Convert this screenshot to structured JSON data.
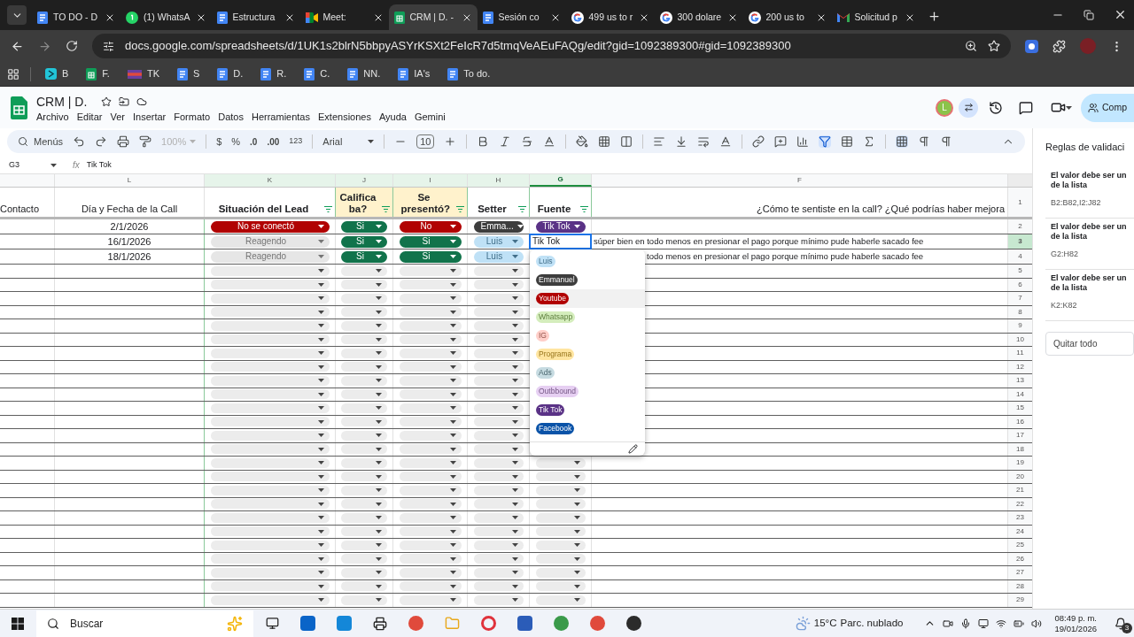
{
  "browser": {
    "tabs": [
      {
        "title": "TO DO - D",
        "kind": "doc",
        "selected": false
      },
      {
        "title": "(1) WhatsA",
        "kind": "chat",
        "selected": false
      },
      {
        "title": "Estructura",
        "kind": "doc",
        "selected": false
      },
      {
        "title": "Meet:",
        "kind": "meet",
        "selected": false
      },
      {
        "title": "CRM | D. -",
        "kind": "sheet",
        "selected": true
      },
      {
        "title": "Sesión co",
        "kind": "doc",
        "selected": false
      },
      {
        "title": "499 us to r",
        "kind": "search",
        "selected": false
      },
      {
        "title": "300 dolare",
        "kind": "search",
        "selected": false
      },
      {
        "title": "200 us to",
        "kind": "search",
        "selected": false
      },
      {
        "title": "Solicitud p",
        "kind": "mail",
        "selected": false
      }
    ],
    "url": "docs.google.com/spreadsheets/d/1UK1s2blrN5bbpyASYrKSXt2FeIcR7d5tmqVeAEuFAQg/edit?gid=1092389300#gid=1092389300",
    "bookmarks": [
      {
        "label": "B",
        "kind": "app"
      },
      {
        "label": "F.",
        "kind": "sheet"
      },
      {
        "label": "TK",
        "kind": "flag"
      },
      {
        "label": "S",
        "kind": "doc"
      },
      {
        "label": "D.",
        "kind": "doc"
      },
      {
        "label": "R.",
        "kind": "doc"
      },
      {
        "label": "C.",
        "kind": "doc"
      },
      {
        "label": "NN.",
        "kind": "doc"
      },
      {
        "label": "IA's",
        "kind": "doc"
      },
      {
        "label": "To do.",
        "kind": "doc"
      }
    ]
  },
  "sheet": {
    "title": "CRM | D.",
    "menu": [
      "Archivo",
      "Editar",
      "Ver",
      "Insertar",
      "Formato",
      "Datos",
      "Herramientas",
      "Extensiones",
      "Ayuda",
      "Gemini"
    ],
    "avatar": "L",
    "share": "Comp"
  },
  "toolbar": {
    "search": "Menús",
    "zoom": "100%",
    "currency": "$",
    "percent": "%",
    "decrease_decimals": ".0",
    "increase_decimals": ".00",
    "number_format": "123",
    "font": "Arial",
    "font_size": "10",
    "filter_on": true
  },
  "formula_bar": {
    "cell": "G3",
    "fx": "fx",
    "value": "Tik Tok"
  },
  "columns": [
    {
      "letter": "L",
      "highlighted": false,
      "selected": false
    },
    {
      "letter": "K",
      "highlighted": true,
      "selected": false
    },
    {
      "letter": "J",
      "highlighted": true,
      "selected": false
    },
    {
      "letter": "I",
      "highlighted": true,
      "selected": false
    },
    {
      "letter": "H",
      "highlighted": true,
      "selected": false
    },
    {
      "letter": "G",
      "highlighted": true,
      "selected": true
    },
    {
      "letter": "F",
      "highlighted": false,
      "selected": false
    }
  ],
  "header_row": {
    "number": "1",
    "cells": [
      {
        "text": "Contacto",
        "bold": false,
        "filter": false,
        "color": "#ffffff"
      },
      {
        "text": "Día y Fecha de la Call",
        "bold": false,
        "filter": false,
        "color": "#ffffff"
      },
      {
        "text": "Situación del Lead",
        "bold": true,
        "filter": true,
        "color": "#ffffff"
      },
      {
        "text": "Califica ba?",
        "bold": true,
        "filter": true,
        "color": "#fff2cc"
      },
      {
        "text": "Se presentó?",
        "bold": true,
        "filter": true,
        "color": "#fff2cc"
      },
      {
        "text": "Setter",
        "bold": true,
        "filter": true,
        "color": "#ffffff"
      },
      {
        "text": "Fuente",
        "bold": true,
        "filter": true,
        "color": "#ffffff"
      },
      {
        "text": "¿Cómo te sentiste en la call? ¿Qué podrías haber mejora",
        "bold": false,
        "filter": false,
        "color": "#ffffff"
      }
    ]
  },
  "rows": [
    {
      "number": "2",
      "selected": false,
      "date": "2/1/2026",
      "lead": {
        "label": "No se conectó",
        "color": "#b10202"
      },
      "califica": {
        "label": "Si",
        "color": "#11734b"
      },
      "presento": {
        "label": "No",
        "color": "#b10202"
      },
      "setter": {
        "label": "Emma...",
        "color": "#3d3d3d"
      },
      "fuente": {
        "kind": "chip",
        "label": "Tik Tok",
        "color": "#5a3286"
      }
    },
    {
      "number": "3",
      "selected": true,
      "date": "16/1/2026",
      "lead": {
        "label": "Reagendo",
        "color": "#e6e6e6"
      },
      "califica": {
        "label": "Si",
        "color": "#11734b"
      },
      "presento": {
        "label": "Si",
        "color": "#11734b"
      },
      "setter": {
        "label": "Luis",
        "color": "#bfe1f6"
      },
      "fuente": {
        "kind": "editing",
        "label": "Tik Tok"
      },
      "comment": "súper bien en todo menos en presionar el pago porque mínimo pude haberle sacado fee"
    },
    {
      "number": "4",
      "selected": false,
      "date": "18/1/2026",
      "lead": {
        "label": "Reagendo",
        "color": "#e6e6e6"
      },
      "califica": {
        "label": "Si",
        "color": "#11734b"
      },
      "presento": {
        "label": "Si",
        "color": "#11734b"
      },
      "setter": {
        "label": "Luis",
        "color": "#bfe1f6"
      },
      "fuente": {
        "kind": "covered"
      },
      "comment": "todo menos en presionar el pago porque mínimo pude haberle sacado fee"
    },
    {
      "number": "5",
      "selected": false,
      "fuente": {
        "kind": "covered"
      }
    },
    {
      "number": "6",
      "selected": false,
      "fuente": {
        "kind": "covered"
      }
    },
    {
      "number": "7",
      "selected": false,
      "fuente": {
        "kind": "covered"
      }
    },
    {
      "number": "8",
      "selected": false,
      "fuente": {
        "kind": "covered"
      }
    },
    {
      "number": "9",
      "selected": false,
      "fuente": {
        "kind": "covered"
      }
    },
    {
      "number": "10",
      "selected": false,
      "fuente": {
        "kind": "covered"
      }
    },
    {
      "number": "11",
      "selected": false,
      "fuente": {
        "kind": "covered"
      }
    },
    {
      "number": "12",
      "selected": false,
      "fuente": {
        "kind": "covered"
      }
    },
    {
      "number": "13",
      "selected": false,
      "fuente": {
        "kind": "covered"
      }
    },
    {
      "number": "14",
      "selected": false,
      "fuente": {
        "kind": "covered"
      }
    },
    {
      "number": "15",
      "selected": false,
      "fuente": {
        "kind": "covered"
      }
    },
    {
      "number": "16",
      "selected": false,
      "fuente": {
        "kind": "covered"
      }
    },
    {
      "number": "17",
      "selected": false,
      "fuente": {
        "kind": "covered"
      }
    },
    {
      "number": "18",
      "selected": false,
      "fuente": {
        "kind": "covered"
      }
    },
    {
      "number": "19",
      "selected": false,
      "fuente": {
        "kind": "empty"
      }
    },
    {
      "number": "20",
      "selected": false,
      "fuente": {
        "kind": "empty"
      }
    },
    {
      "number": "21",
      "selected": false,
      "fuente": {
        "kind": "empty"
      }
    },
    {
      "number": "22",
      "selected": false,
      "fuente": {
        "kind": "empty"
      }
    },
    {
      "number": "23",
      "selected": false,
      "fuente": {
        "kind": "empty"
      }
    },
    {
      "number": "24",
      "selected": false,
      "fuente": {
        "kind": "empty"
      }
    },
    {
      "number": "25",
      "selected": false,
      "fuente": {
        "kind": "empty"
      }
    },
    {
      "number": "26",
      "selected": false,
      "fuente": {
        "kind": "empty"
      }
    },
    {
      "number": "27",
      "selected": false,
      "fuente": {
        "kind": "empty"
      }
    },
    {
      "number": "28",
      "selected": false,
      "fuente": {
        "kind": "empty"
      }
    },
    {
      "number": "29",
      "selected": false,
      "fuente": {
        "kind": "empty"
      }
    }
  ],
  "dropdown": {
    "items": [
      {
        "label": "Luis",
        "color": "#bfe1f6",
        "hovered": false
      },
      {
        "label": "Emmanuel",
        "color": "#3d3d3d",
        "hovered": false
      },
      {
        "label": "Youtube",
        "color": "#b10202",
        "hovered": true
      },
      {
        "label": "Whatsapp",
        "color": "#d4edbc",
        "hovered": false
      },
      {
        "label": "IG",
        "color": "#ffcfc9",
        "hovered": false
      },
      {
        "label": "Programa",
        "color": "#ffe5a0",
        "hovered": false
      },
      {
        "label": "Ads",
        "color": "#c6dbe1",
        "hovered": false
      },
      {
        "label": "Outbbound",
        "color": "#e6cff2",
        "hovered": false
      },
      {
        "label": "Tik Tok",
        "color": "#5a3286",
        "hovered": false
      },
      {
        "label": "Facebook",
        "color": "#0a53a8",
        "hovered": false
      }
    ]
  },
  "panel": {
    "title": "Reglas de validaci",
    "rules": [
      {
        "text": "El valor debe ser un de la lista",
        "range": "B2:B82,I2:J82"
      },
      {
        "text": "El valor debe ser un de la lista",
        "range": "G2:H82"
      },
      {
        "text": "El valor debe ser un de la lista",
        "range": "K2:K82"
      }
    ],
    "button": "Quitar todo"
  },
  "taskbar": {
    "search": "Buscar",
    "temperature": "15°C",
    "weather": "Parc. nublado",
    "time": "08:49 p. m.",
    "date": "19/01/2026",
    "notifications": "3"
  }
}
